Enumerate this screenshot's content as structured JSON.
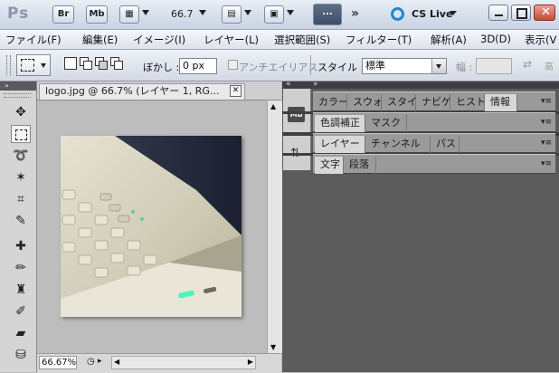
{
  "appbar": {
    "logo": "Ps",
    "bridge_label": "Br",
    "minibridge_label": "Mb",
    "zoom": "66.7",
    "more_label": "...",
    "cslive": "CS Live"
  },
  "menu": [
    "ファイル(F)",
    "編集(E)",
    "イメージ(I)",
    "レイヤー(L)",
    "選択範囲(S)",
    "フィルター(T)",
    "解析(A)",
    "3D(D)",
    "表示(V"
  ],
  "options": {
    "feather_label": "ぼかし :",
    "feather_value": "0 px",
    "antialias_label": "アンチエイリアス",
    "style_label": "スタイル :",
    "style_value": "標準",
    "width_label": "幅 :"
  },
  "document": {
    "tab_title": "logo.jpg @ 66.7% (レイヤー 1, RG...",
    "zoom_status": "66.67%"
  },
  "panels": {
    "group1": [
      "カラー",
      "スウォ",
      "スタイ",
      "ナビゲ",
      "ヒスト",
      "情報"
    ],
    "group1_active": 5,
    "group2": [
      "色調補正",
      "マスク"
    ],
    "group3": [
      "レイヤー",
      "チャンネル",
      "パス"
    ],
    "group4": [
      "文字",
      "段落"
    ],
    "mb_icon_label": "Mb"
  },
  "colors": {
    "accent": "#1e88c8",
    "panel_bg": "#5c5c5c"
  }
}
